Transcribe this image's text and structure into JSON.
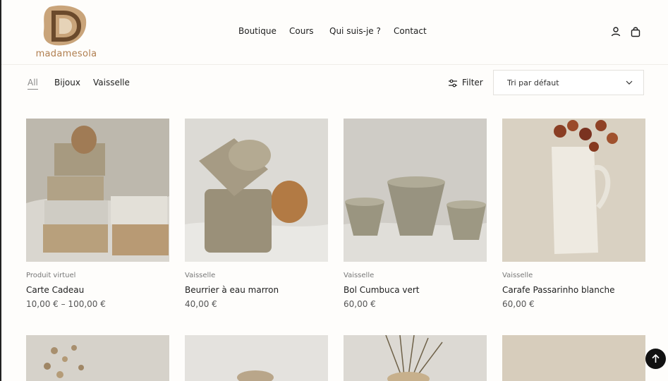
{
  "brand": {
    "logo_text": "madamesola"
  },
  "nav": {
    "items": [
      "Boutique",
      "Cours",
      "Qui suis-je ?",
      "Contact"
    ]
  },
  "header_icons": [
    "account-icon",
    "bag-icon"
  ],
  "filters": {
    "tabs": [
      "All",
      "Bijoux",
      "Vaisselle"
    ],
    "active": "All",
    "filter_label": "Filter"
  },
  "sort": {
    "selected": "Tri par défaut"
  },
  "products": [
    {
      "category": "Produit virtuel",
      "name": "Carte Cadeau",
      "price": "10,00 € – 100,00 €"
    },
    {
      "category": "Vaisselle",
      "name": "Beurrier à eau marron",
      "price": "40,00 €"
    },
    {
      "category": "Vaisselle",
      "name": "Bol Cumbuca vert",
      "price": "60,00 €"
    },
    {
      "category": "Vaisselle",
      "name": "Carafe Passarinho blanche",
      "price": "60,00 €"
    }
  ],
  "colors": {
    "accent": "#b07e4f",
    "text": "#1e1e1e",
    "muted": "#8a8a8a"
  }
}
